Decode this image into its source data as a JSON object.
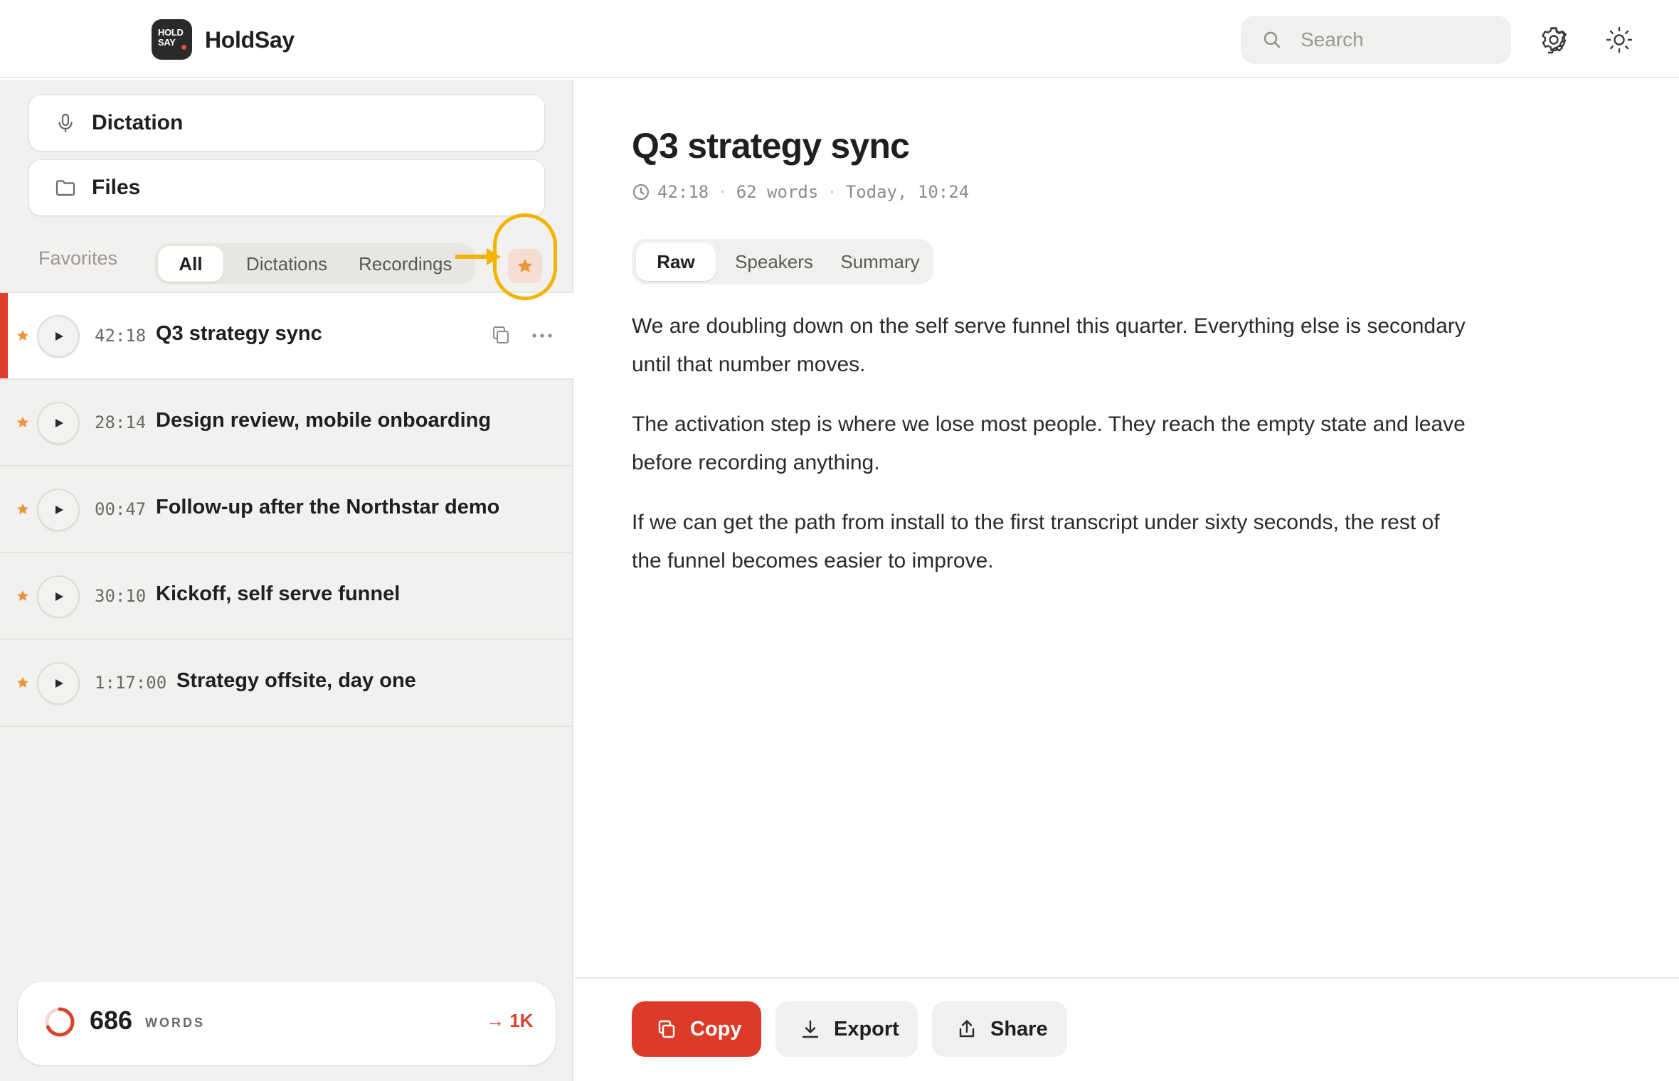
{
  "app": {
    "name": "HoldSay",
    "logo_text": [
      "HOLD",
      "SAY"
    ]
  },
  "header": {
    "search_placeholder": "Search",
    "icons": [
      "search-icon",
      "gear-icon",
      "sun-icon"
    ]
  },
  "sidebar": {
    "nav": [
      {
        "label": "Dictation",
        "icon": "microphone-icon"
      },
      {
        "label": "Files",
        "icon": "folder-icon"
      }
    ],
    "favorites_label": "Favorites",
    "filters": [
      {
        "label": "All",
        "selected": true
      },
      {
        "label": "Dictations",
        "selected": false
      },
      {
        "label": "Recordings",
        "selected": false
      }
    ],
    "star_filter_active": true,
    "items": [
      {
        "duration": "42:18",
        "title": "Q3 strategy sync",
        "starred": true,
        "active": true
      },
      {
        "duration": "28:14",
        "title": "Design review, mobile onboarding",
        "starred": true,
        "active": false
      },
      {
        "duration": "00:47",
        "title": "Follow-up after the Northstar demo",
        "starred": true,
        "active": false
      },
      {
        "duration": "30:10",
        "title": "Kickoff, self serve funnel",
        "starred": true,
        "active": false
      },
      {
        "duration": "1:17:00",
        "title": "Strategy offsite, day one",
        "starred": true,
        "active": false
      }
    ],
    "usage": {
      "count": "686",
      "unit": "WORDS",
      "goal": "→ 1K",
      "progress": 0.686
    }
  },
  "document": {
    "title": "Q3 strategy sync",
    "meta": {
      "duration": "42:18",
      "words": "62 words",
      "date": "Today, 10:24",
      "separator": "·"
    },
    "tabs": [
      {
        "label": "Raw",
        "selected": true
      },
      {
        "label": "Speakers",
        "selected": false
      },
      {
        "label": "Summary",
        "selected": false
      }
    ],
    "paragraphs": [
      "We are doubling down on the self serve funnel this quarter. Everything else is secondary until that number moves.",
      "The activation step is where we lose most people. They reach the empty state and leave before recording anything.",
      "If we can get the path from install to the first transcript under sixty seconds, the rest of the funnel becomes easier to improve."
    ]
  },
  "actions": {
    "copy": "Copy",
    "export": "Export",
    "share": "Share"
  },
  "colors": {
    "accent": "#dd3b29",
    "star": "#e8963a",
    "annotation": "#f2b400",
    "sidebar_bg": "#f2f1ef"
  }
}
